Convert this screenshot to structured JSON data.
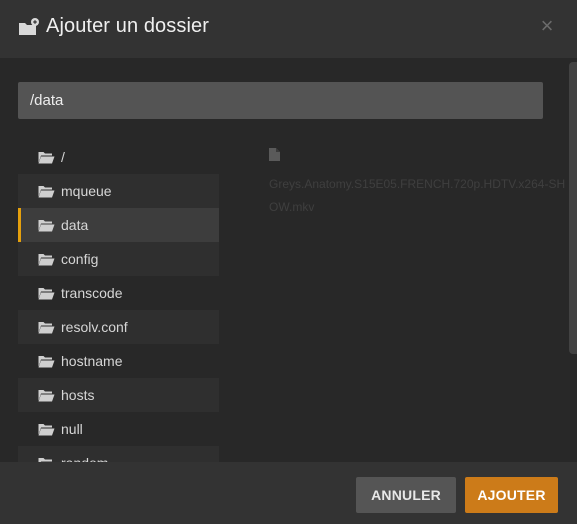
{
  "dialog": {
    "title": "Ajouter un dossier",
    "close_glyph": "×"
  },
  "path": {
    "value": "/data"
  },
  "directories": [
    {
      "label": "/",
      "selected": false
    },
    {
      "label": "mqueue",
      "selected": false
    },
    {
      "label": "data",
      "selected": true
    },
    {
      "label": "config",
      "selected": false
    },
    {
      "label": "transcode",
      "selected": false
    },
    {
      "label": "resolv.conf",
      "selected": false
    },
    {
      "label": "hostname",
      "selected": false
    },
    {
      "label": "hosts",
      "selected": false
    },
    {
      "label": "null",
      "selected": false
    },
    {
      "label": "random",
      "selected": false
    }
  ],
  "files": [
    {
      "name": "Greys.Anatomy.S15E05.FRENCH.720p.HDTV.x264-SHOW.mkv"
    }
  ],
  "footer": {
    "cancel_label": "ANNULER",
    "add_label": "AJOUTER"
  },
  "colors": {
    "accent": "#e5a00d",
    "primary_button": "#cc7b19",
    "secondary_button": "#555555"
  }
}
